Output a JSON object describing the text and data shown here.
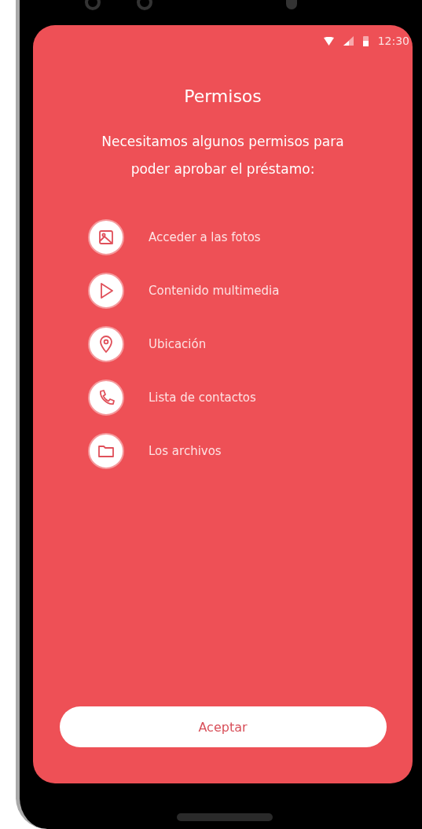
{
  "status_bar": {
    "time": "12:30"
  },
  "title": "Permisos",
  "subtitle": "Necesitamos algunos permisos para poder aprobar el préstamo:",
  "permissions": [
    {
      "kind": "photo",
      "label": "Acceder a las fotos"
    },
    {
      "kind": "play",
      "label": "Contenido multimedia"
    },
    {
      "kind": "location",
      "label": "Ubicación"
    },
    {
      "kind": "phone",
      "label": "Lista de contactos"
    },
    {
      "kind": "folder",
      "label": "Los archivos"
    }
  ],
  "button": "Aceptar"
}
